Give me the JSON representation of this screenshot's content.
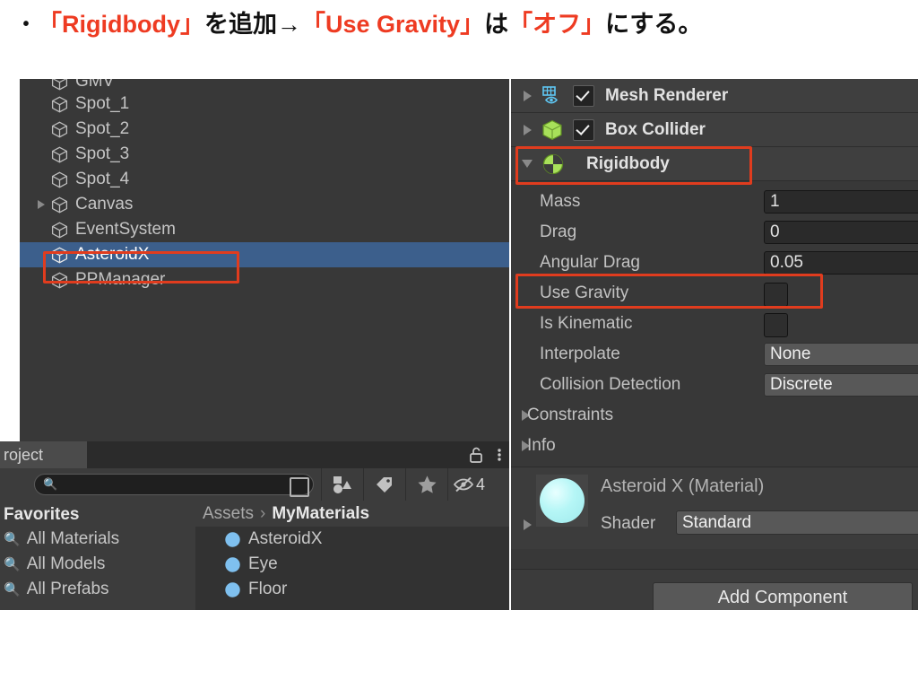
{
  "slide": {
    "bullet": "•",
    "heading_parts": [
      {
        "text": "「Rigidbody」",
        "style": "highlight"
      },
      {
        "text": "を追加→",
        "style": "normal"
      },
      {
        "text": "「Use Gravity」",
        "style": "highlight"
      },
      {
        "text": "は",
        "style": "normal"
      },
      {
        "text": "「オフ」",
        "style": "highlight"
      },
      {
        "text": "にする。",
        "style": "normal"
      }
    ],
    "heading_full": "「Rigidbody」を追加→「Use Gravity」は「オフ」にする。",
    "heading_highlight_color": "#ee3b22",
    "heading_text_color": "#111111"
  },
  "hierarchy": {
    "items": [
      {
        "label": "GMV",
        "has_arrow": false,
        "selected": false,
        "clipped": true
      },
      {
        "label": "Spot_1",
        "has_arrow": false,
        "selected": false
      },
      {
        "label": "Spot_2",
        "has_arrow": false,
        "selected": false
      },
      {
        "label": "Spot_3",
        "has_arrow": false,
        "selected": false
      },
      {
        "label": "Spot_4",
        "has_arrow": false,
        "selected": false
      },
      {
        "label": "Canvas",
        "has_arrow": true,
        "selected": false
      },
      {
        "label": "EventSystem",
        "has_arrow": false,
        "selected": false
      },
      {
        "label": "AsteroidX",
        "has_arrow": false,
        "selected": true
      },
      {
        "label": "PPManager",
        "has_arrow": false,
        "selected": false
      }
    ],
    "selection_color": "#3c5f8c"
  },
  "project": {
    "tab_label": "roject",
    "lock_icon": "unlocked-padlock-icon",
    "menu_icon": "kebab-menu-icon",
    "search": {
      "value": "",
      "placeholder": ""
    },
    "toolbar_buttons": [
      {
        "icon": "shapes-filter-icon",
        "label": ""
      },
      {
        "icon": "label-tag-icon",
        "label": ""
      },
      {
        "icon": "star-favorite-icon",
        "label": ""
      },
      {
        "icon": "hidden-eye-icon",
        "label": "4"
      }
    ],
    "favorites": {
      "title": "Favorites",
      "items": [
        "All Materials",
        "All Models",
        "All Prefabs"
      ]
    },
    "breadcrumb": {
      "root": "Assets",
      "separator": "›",
      "current": "MyMaterials"
    },
    "assets": [
      "AsteroidX",
      "Eye",
      "Floor"
    ]
  },
  "inspector": {
    "components": [
      {
        "name": "Mesh Renderer",
        "icon": "mesh-renderer-icon",
        "expanded": false,
        "enabled": true
      },
      {
        "name": "Box Collider",
        "icon": "box-collider-icon",
        "expanded": false,
        "enabled": true
      },
      {
        "name": "Rigidbody",
        "icon": "rigidbody-icon",
        "expanded": true,
        "enabled": null
      }
    ],
    "rigidbody_properties": [
      {
        "label": "Mass",
        "type": "field",
        "value": "1"
      },
      {
        "label": "Drag",
        "type": "field",
        "value": "0"
      },
      {
        "label": "Angular Drag",
        "type": "field",
        "value": "0.05"
      },
      {
        "label": "Use Gravity",
        "type": "checkbox",
        "checked": false
      },
      {
        "label": "Is Kinematic",
        "type": "checkbox",
        "checked": false
      },
      {
        "label": "Interpolate",
        "type": "dropdown",
        "value": "None"
      },
      {
        "label": "Collision Detection",
        "type": "dropdown",
        "value": "Discrete"
      },
      {
        "label": "Constraints",
        "type": "foldout"
      },
      {
        "label": "Info",
        "type": "foldout"
      }
    ],
    "material": {
      "title": "Asteroid X (Material)",
      "shader_label": "Shader",
      "shader_value": "Standard",
      "swatch_color": "#b5f6f6"
    },
    "add_component_label": "Add Component"
  },
  "annotations": {
    "color": "#e03c1e",
    "boxes": [
      "hierarchy-asteroidx-row",
      "inspector-rigidbody-header",
      "inspector-use-gravity-row"
    ]
  }
}
